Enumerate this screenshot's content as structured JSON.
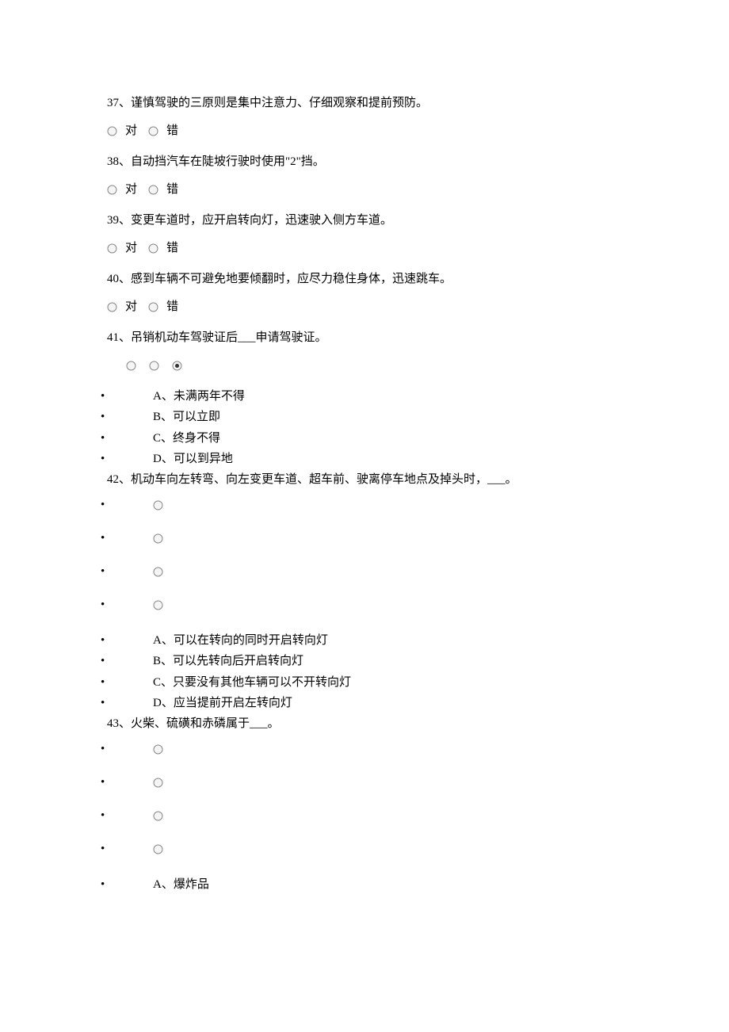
{
  "labels": {
    "true": "对",
    "false": "错"
  },
  "questions": [
    {
      "number": "37、",
      "text": "谨慎驾驶的三原则是集中注意力、仔细观察和提前预防。",
      "type": "tf"
    },
    {
      "number": "38、",
      "text": "自动挡汽车在陡坡行驶时使用\"2\"挡。",
      "type": "tf"
    },
    {
      "number": "39、",
      "text": "变更车道时，应开启转向灯，迅速驶入侧方车道。",
      "type": "tf"
    },
    {
      "number": "40、",
      "text": "感到车辆不可避免地要倾翻时，应尽力稳住身体，迅速跳车。",
      "type": "tf"
    },
    {
      "number": "41、",
      "text": "吊销机动车驾驶证后___申请驾驶证。",
      "type": "mc_inline",
      "selected": 2,
      "options": [
        "A、未满两年不得",
        "B、可以立即",
        "C、终身不得",
        "D、可以到异地"
      ]
    },
    {
      "number": "42、",
      "text": "机动车向左转弯、向左变更车道、超车前、驶离停车地点及掉头时，___。",
      "type": "mc_vertical",
      "options": [
        "A、可以在转向的同时开启转向灯",
        "B、可以先转向后开启转向灯",
        "C、只要没有其他车辆可以不开转向灯",
        "D、应当提前开启左转向灯"
      ]
    },
    {
      "number": "43、",
      "text": "火柴、硫磺和赤磷属于___。",
      "type": "mc_vertical_partial",
      "options": [
        "A、爆炸品"
      ]
    }
  ]
}
